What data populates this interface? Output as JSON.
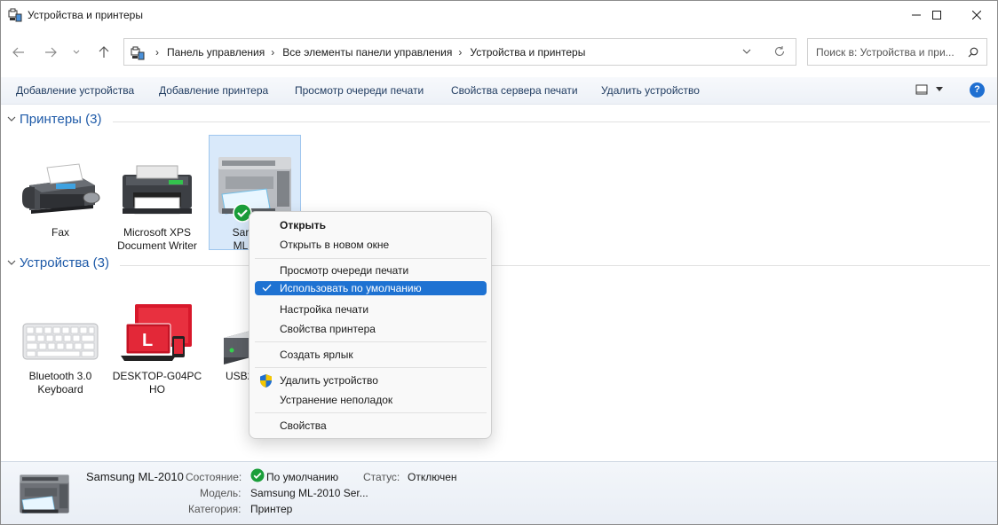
{
  "window": {
    "title": "Устройства и принтеры",
    "icon": "devices-printers-icon"
  },
  "address": {
    "crumbs": [
      "Панель управления",
      "Все элементы панели управления",
      "Устройства и принтеры"
    ]
  },
  "search": {
    "placeholder": "Поиск в: Устройства и при..."
  },
  "commands": {
    "add_device": "Добавление устройства",
    "add_printer": "Добавление принтера",
    "view_queue": "Просмотр очереди печати",
    "server_props": "Свойства сервера печати",
    "remove_device": "Удалить устройство"
  },
  "groups": {
    "printers": "Принтеры (3)",
    "devices": "Устройства (3)"
  },
  "printers": [
    {
      "label": "Fax"
    },
    {
      "label": "Microsoft XPS Document Writer"
    },
    {
      "label": "Samsung ML-2010",
      "visible_label": "Sar ML"
    }
  ],
  "devices": [
    {
      "label": "Bluetooth 3.0 Keyboard"
    },
    {
      "label": "DESKTOP-G04PC HO"
    },
    {
      "label": "USB2"
    }
  ],
  "context_menu": {
    "open": "Открыть",
    "open_new_window": "Открыть в новом окне",
    "view_queue": "Просмотр очереди печати",
    "set_default": "Использовать по умолчанию",
    "print_setup": "Настройка печати",
    "printer_props": "Свойства принтера",
    "create_shortcut": "Создать ярлык",
    "remove_device": "Удалить устройство",
    "troubleshoot": "Устранение неполадок",
    "properties": "Свойства"
  },
  "details": {
    "name": "Samsung ML-2010",
    "state_label": "Состояние:",
    "state_value": "По умолчанию",
    "status_label": "Статус:",
    "status_value": "Отключен",
    "model_label": "Модель:",
    "model_value": "Samsung ML-2010 Ser...",
    "category_label": "Категория:",
    "category_value": "Принтер"
  },
  "colors": {
    "accent": "#1e72d2",
    "link": "#1e5aa8",
    "default_check": "#1a9e3a"
  }
}
